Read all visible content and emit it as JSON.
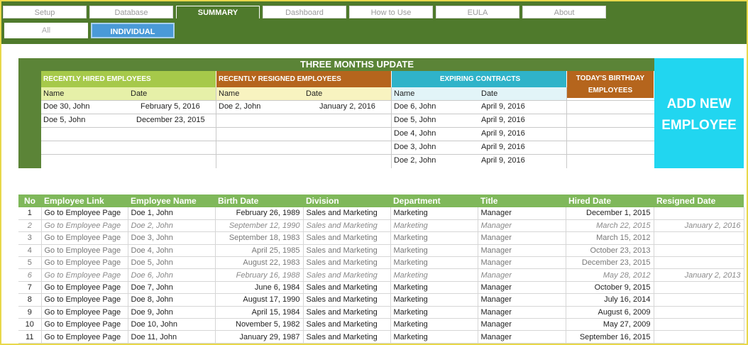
{
  "tabs": [
    {
      "label": "Setup",
      "active": false
    },
    {
      "label": "Database",
      "active": false
    },
    {
      "label": "SUMMARY",
      "active": true
    },
    {
      "label": "Dashboard",
      "active": false
    },
    {
      "label": "How to Use",
      "active": false
    },
    {
      "label": "EULA",
      "active": false
    },
    {
      "label": "About",
      "active": false
    }
  ],
  "subtabs": {
    "all": "All",
    "individual": "INDIVIDUAL"
  },
  "update": {
    "title": "THREE MONTHS UPDATE",
    "sections": {
      "hired": "RECENTLY HIRED EMPLOYEES",
      "resigned": "RECENTLY RESIGNED EMPLOYEES",
      "expiring": "EXPIRING CONTRACTS",
      "birthday": "TODAY'S BIRTHDAY EMPLOYEES"
    },
    "col_name": "Name",
    "col_date": "Date",
    "hired_rows": [
      {
        "name": "Doe 30, John",
        "date": "February 5, 2016"
      },
      {
        "name": "Doe 5, John",
        "date": "December 23, 2015"
      }
    ],
    "resigned_rows": [
      {
        "name": "Doe 2, John",
        "date": "January 2, 2016"
      }
    ],
    "expiring_rows": [
      {
        "name": "Doe 6, John",
        "date": "April 9, 2016"
      },
      {
        "name": "Doe 5, John",
        "date": "April 9, 2016"
      },
      {
        "name": "Doe 4, John",
        "date": "April 9, 2016"
      },
      {
        "name": "Doe 3, John",
        "date": "April 9, 2016"
      },
      {
        "name": "Doe 2, John",
        "date": "April 9, 2016"
      }
    ],
    "add_new": "ADD NEW EMPLOYEE"
  },
  "table": {
    "headers": [
      "No",
      "Employee Link",
      "Employee Name",
      "Birth Date",
      "Division",
      "Department",
      "Title",
      "Hired Date",
      "Resigned Date"
    ],
    "rows": [
      {
        "no": "1",
        "link": "Go to Employee Page",
        "name": "Doe 1, John",
        "birth": "February 26, 1989",
        "division": "Sales and Marketing",
        "dept": "Marketing",
        "title": "Manager",
        "hired": "December 1, 2015",
        "resigned": "",
        "style": "normal"
      },
      {
        "no": "2",
        "link": "Go to Employee Page",
        "name": "Doe 2, John",
        "birth": "September 12, 1990",
        "division": "Sales and Marketing",
        "dept": "Marketing",
        "title": "Manager",
        "hired": "March 22, 2015",
        "resigned": "January 2, 2016",
        "style": "faded"
      },
      {
        "no": "3",
        "link": "Go to Employee Page",
        "name": "Doe 3, John",
        "birth": "September 18, 1983",
        "division": "Sales and Marketing",
        "dept": "Marketing",
        "title": "Manager",
        "hired": "March 15, 2012",
        "resigned": "",
        "style": "light"
      },
      {
        "no": "4",
        "link": "Go to Employee Page",
        "name": "Doe 4, John",
        "birth": "April 25, 1985",
        "division": "Sales and Marketing",
        "dept": "Marketing",
        "title": "Manager",
        "hired": "October 23, 2013",
        "resigned": "",
        "style": "light"
      },
      {
        "no": "5",
        "link": "Go to Employee Page",
        "name": "Doe 5, John",
        "birth": "August 22, 1983",
        "division": "Sales and Marketing",
        "dept": "Marketing",
        "title": "Manager",
        "hired": "December 23, 2015",
        "resigned": "",
        "style": "light"
      },
      {
        "no": "6",
        "link": "Go to Employee Page",
        "name": "Doe 6, John",
        "birth": "February 16, 1988",
        "division": "Sales and Marketing",
        "dept": "Marketing",
        "title": "Manager",
        "hired": "May 28, 2012",
        "resigned": "January 2, 2013",
        "style": "faded"
      },
      {
        "no": "7",
        "link": "Go to Employee Page",
        "name": "Doe 7, John",
        "birth": "June 6, 1984",
        "division": "Sales and Marketing",
        "dept": "Marketing",
        "title": "Manager",
        "hired": "October 9, 2015",
        "resigned": "",
        "style": "normal"
      },
      {
        "no": "8",
        "link": "Go to Employee Page",
        "name": "Doe 8, John",
        "birth": "August 17, 1990",
        "division": "Sales and Marketing",
        "dept": "Marketing",
        "title": "Manager",
        "hired": "July 16, 2014",
        "resigned": "",
        "style": "normal"
      },
      {
        "no": "9",
        "link": "Go to Employee Page",
        "name": "Doe 9, John",
        "birth": "April 15, 1984",
        "division": "Sales and Marketing",
        "dept": "Marketing",
        "title": "Manager",
        "hired": "August 6, 2009",
        "resigned": "",
        "style": "normal"
      },
      {
        "no": "10",
        "link": "Go to Employee Page",
        "name": "Doe 10, John",
        "birth": "November 5, 1982",
        "division": "Sales and Marketing",
        "dept": "Marketing",
        "title": "Manager",
        "hired": "May 27, 2009",
        "resigned": "",
        "style": "normal"
      },
      {
        "no": "11",
        "link": "Go to Employee Page",
        "name": "Doe 11, John",
        "birth": "January 29, 1987",
        "division": "Sales and Marketing",
        "dept": "Marketing",
        "title": "Manager",
        "hired": "September 16, 2015",
        "resigned": "",
        "style": "normal"
      }
    ]
  },
  "colors": {
    "green_dark": "#4f7a2c",
    "green_mid": "#5b8437",
    "green_light": "#7fb85a",
    "lime": "#a6c94a",
    "orange": "#b5651d",
    "teal": "#2fb3c9",
    "cyan": "#21d6f0",
    "blue": "#4a9ad8"
  }
}
